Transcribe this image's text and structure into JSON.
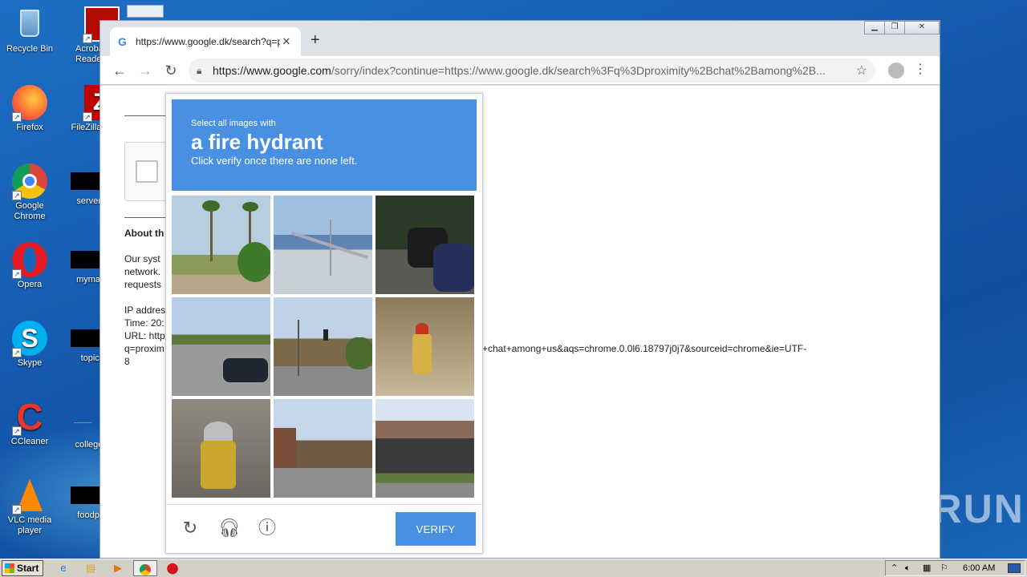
{
  "desktop_icons": [
    {
      "label": "Recycle Bin",
      "icon": "recycle-bin-icon"
    },
    {
      "label": "Acrobat Reader",
      "icon": "acrobat-icon"
    },
    {
      "label": "Firefox",
      "icon": "firefox-icon"
    },
    {
      "label": "FileZilla C",
      "icon": "filezilla-icon"
    },
    {
      "label": "Google Chrome",
      "icon": "chrome-icon"
    },
    {
      "label": "serveradi",
      "icon": "file-icon"
    },
    {
      "label": "Opera",
      "icon": "opera-icon"
    },
    {
      "label": "mymatter",
      "icon": "file-icon"
    },
    {
      "label": "Skype",
      "icon": "skype-icon"
    },
    {
      "label": "topico.j",
      "icon": "file-icon"
    },
    {
      "label": "CCleaner",
      "icon": "ccleaner-icon"
    },
    {
      "label": "collegelite",
      "icon": "file-icon"
    },
    {
      "label": "VLC media player",
      "icon": "vlc-icon"
    },
    {
      "label": "foodpurp",
      "icon": "file-icon"
    }
  ],
  "browser": {
    "tab_title": "https://www.google.dk/search?q=p",
    "url_host": "https://www.google.com",
    "url_path": "/sorry/index?continue=https://www.google.dk/search%3Fq%3Dproximity%2Bchat%2Bamong%2B..."
  },
  "page": {
    "about_heading": "About th",
    "para1": [
      "Our syst",
      "network.",
      "requests"
    ],
    "para2": [
      "IP addres",
      "Time: 20:",
      "URL: http",
      "q=proxim",
      "8"
    ],
    "url_tail": "+chat+among+us&aqs=chrome.0.0l6.18797j0j7&sourceid=chrome&ie=UTF-"
  },
  "captcha": {
    "instruction_top": "Select all images with",
    "target": "a fire hydrant",
    "instruction_bottom": "Click verify once there are none left.",
    "verify_label": "VERIFY",
    "tiles": [
      "palm-trees-street",
      "bridge-road",
      "parked-scooter",
      "highway-car",
      "town-street-traffic-light",
      "fire-hydrant-hillside",
      "fire-hydrant-closeup",
      "main-street-buildings",
      "overpass-bridge"
    ]
  },
  "taskbar": {
    "start_label": "Start",
    "clock": "6:00 AM"
  },
  "watermark": "ANY RUN"
}
